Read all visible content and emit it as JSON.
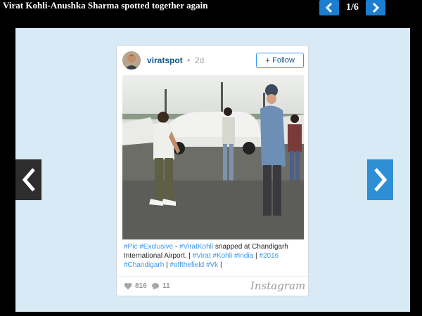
{
  "header": {
    "title": "Virat Kohli-Anushka Sharma spotted together again",
    "pager": {
      "current": "1/6"
    }
  },
  "post": {
    "username": "viratspot",
    "separator": "•",
    "time_ago": "2d",
    "follow": {
      "plus": "+",
      "label": "Follow"
    },
    "caption": {
      "tag1": "#Pic",
      "tag2": "#Exclusive",
      "sep1": " - ",
      "tag3": "#ViratKohli",
      "text1": " snapped at Chandigarh International Airport. | ",
      "tag4": "#Virat",
      "tag5": "#Kohli",
      "tag6": "#India",
      "sep2": " | ",
      "tag7": "#2016",
      "tag8": "#Chandigarh",
      "sep3": " | ",
      "tag9": "#offthefield",
      "tag10": "#Vk",
      "end": " |"
    },
    "likes": "816",
    "comments": "11",
    "brand": "Instagram"
  },
  "colors": {
    "accent": "#1a7fd1",
    "stage_bg": "#d7eaf5",
    "link": "#3897f0",
    "username": "#125688"
  },
  "icons": [
    "chevron-left-icon",
    "chevron-right-icon",
    "heart-icon",
    "comment-icon",
    "instagram-logo"
  ]
}
